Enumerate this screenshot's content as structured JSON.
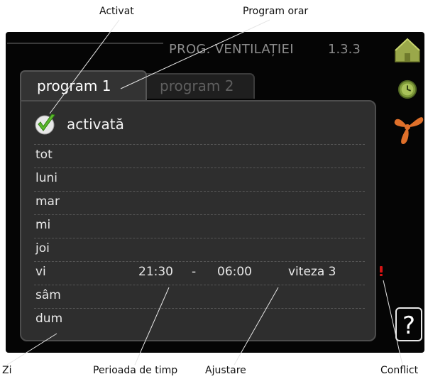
{
  "callouts": {
    "activated": "Activat",
    "schedule": "Program orar",
    "day": "Zi",
    "time_period": "Perioada de timp",
    "setting": "Ajustare",
    "conflict": "Conflict"
  },
  "header": {
    "title": "PROG. VENTILAȚIEI",
    "menu_number": "1.3.3"
  },
  "tabs": [
    {
      "label": "program 1",
      "active": true
    },
    {
      "label": "program 2",
      "active": false
    }
  ],
  "schedule": {
    "active_label": "activată",
    "days": [
      {
        "name": "tot",
        "start": "",
        "end": "",
        "setting": ""
      },
      {
        "name": "luni",
        "start": "",
        "end": "",
        "setting": ""
      },
      {
        "name": "mar",
        "start": "",
        "end": "",
        "setting": ""
      },
      {
        "name": "mi",
        "start": "",
        "end": "",
        "setting": ""
      },
      {
        "name": "joi",
        "start": "",
        "end": "",
        "setting": ""
      },
      {
        "name": "vi",
        "start": "21:30",
        "separator": "-",
        "end": "06:00",
        "setting": "viteza 3",
        "conflict": true
      },
      {
        "name": "sâm",
        "start": "",
        "end": "",
        "setting": ""
      },
      {
        "name": "dum",
        "start": "",
        "end": "",
        "setting": ""
      }
    ]
  },
  "icons": {
    "house": "house-icon",
    "clock": "clock-icon",
    "fan": "fan-icon",
    "help": "?"
  },
  "colors": {
    "screen_bg": "#050505",
    "panel_bg": "#2e2e2e",
    "check_green": "#5cb82c",
    "conflict_red": "#d41414",
    "fan_orange": "#e0702a"
  }
}
